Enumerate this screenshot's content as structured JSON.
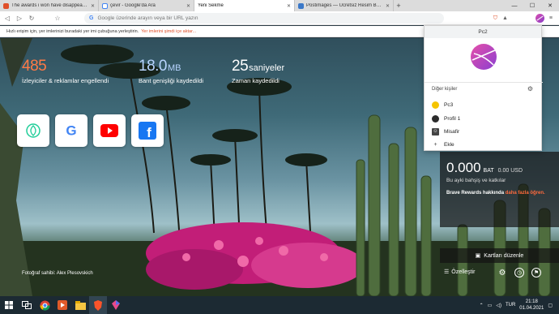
{
  "tabs": [
    {
      "title": "The awards i won have disappeared - B",
      "icon": "brave-community-icon",
      "color": "#e0502a",
      "active": false
    },
    {
      "title": "çevir - Google'da Ara",
      "icon": "google-icon",
      "color": "#4285f4",
      "active": false
    },
    {
      "title": "Yeni Sekme",
      "icon": "",
      "color": "",
      "active": true
    },
    {
      "title": "Postimages — Ücretsiz Resim Barındır",
      "icon": "postimages-icon",
      "color": "#3b78c8",
      "active": false
    }
  ],
  "toolbar": {
    "url_placeholder": "Google üzerinde arayın veya bir URL yazın"
  },
  "bookmarks_hint": {
    "text": "Hızlı erişim için, yer imlerinizi buradaki yer imi çubuğuna yerleştirin.",
    "link": "Yer imlerini şimdi içe aktar..."
  },
  "stats": [
    {
      "value": "485",
      "unit": "",
      "label": "İzleyiciler & reklamlar engellendi",
      "color": "#ff7a45"
    },
    {
      "value": "18.0",
      "unit": "MB",
      "label": "Bant genişliği kaydedildi",
      "color": "#b8d4ff"
    },
    {
      "value": "25",
      "unit": "saniyeler",
      "label": "Zaman kaydedildi",
      "color": "#ffffff"
    }
  ],
  "tiles": [
    {
      "name": "robinhood-icon",
      "color": "#21ce99"
    },
    {
      "name": "google-icon",
      "color": "#4285f4"
    },
    {
      "name": "youtube-icon",
      "color": "#ff0000"
    },
    {
      "name": "facebook-icon",
      "color": "#1877f2"
    }
  ],
  "photo_credit": "Fotoğraf sahibi: Alex Plesovskich",
  "rewards": {
    "amount": "0.000",
    "currency": "BAT",
    "usd": "0.00 USD",
    "subtitle": "Bu ayki bahşiş ve katkılar",
    "note": "Brave Rewards hakkında ",
    "note_link": "daha fazla öğren.",
    "cards_edit": "Kartları düzenle"
  },
  "customize_label": "Özelleştir",
  "profile_popup": {
    "title": "Pc2",
    "others_label": "Diğer kişiler",
    "people": [
      {
        "label": "Pc3",
        "icon": "profile-pc3-icon"
      },
      {
        "label": "Profil 1",
        "icon": "profile-1-icon"
      },
      {
        "label": "Misafir",
        "icon": "guest-icon"
      },
      {
        "label": "Ekle",
        "icon": "add-icon"
      }
    ]
  },
  "taskbar": {
    "lang": "TUR",
    "time": "21:18",
    "date": "01.04.2021"
  }
}
